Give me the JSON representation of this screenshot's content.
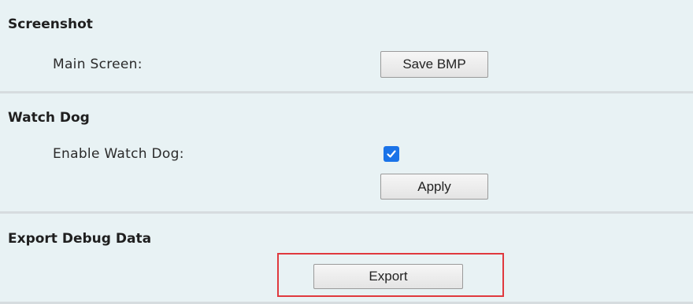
{
  "screenshot": {
    "title": "Screenshot",
    "main_screen_label": "Main Screen:",
    "save_button_label": "Save BMP"
  },
  "watchdog": {
    "title": "Watch Dog",
    "enable_label": "Enable Watch Dog:",
    "enabled": true,
    "apply_button_label": "Apply"
  },
  "export_debug": {
    "title": "Export Debug Data",
    "export_button_label": "Export"
  },
  "colors": {
    "section_background": "#e8f2f4",
    "checkbox_checked": "#1a73e8",
    "highlight_border": "#e0393e"
  }
}
